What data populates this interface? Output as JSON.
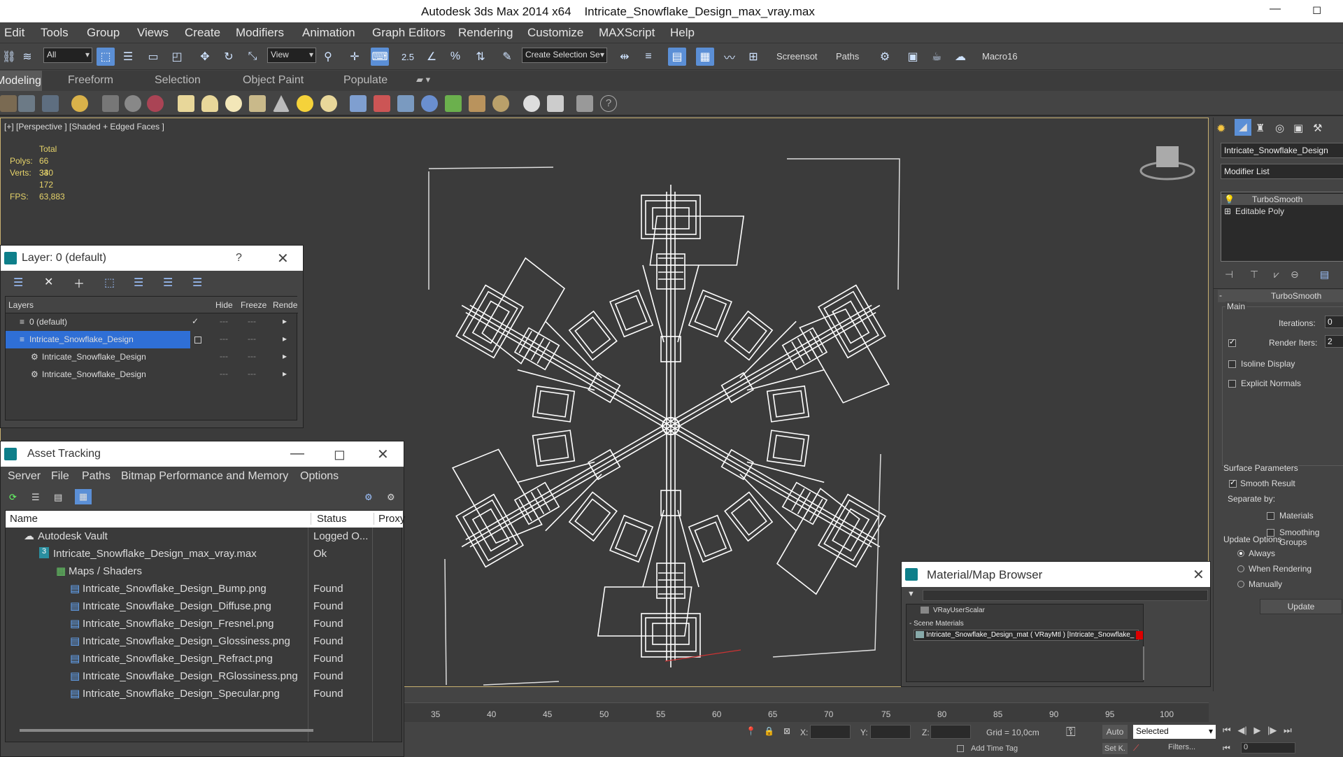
{
  "title_bar": {
    "app": "Autodesk 3ds Max 2014 x64",
    "file": "Intricate_Snowflake_Design_max_vray.max",
    "min": "—",
    "max": "◻"
  },
  "menu": [
    "Edit",
    "Tools",
    "Group",
    "Views",
    "Create",
    "Modifiers",
    "Animation",
    "Graph Editors",
    "Rendering",
    "Customize",
    "MAXScript",
    "Help"
  ],
  "toolbar": {
    "filter_select": "All",
    "ref_coord": "View",
    "snap_label": "2.5",
    "named_selection": "Create Selection Se",
    "screenshot": "Screensot",
    "paths": "Paths",
    "macro": "Macro16"
  },
  "ribbon_tabs": [
    "Modeling",
    "Freeform",
    "Selection",
    "Object Paint",
    "Populate"
  ],
  "viewport": {
    "label": "[+] [Perspective ] [Shaded + Edged Faces ]",
    "stats": {
      "total_label": "Total",
      "polys_label": "Polys:",
      "polys": "66 340",
      "verts_label": "Verts:",
      "verts": "33 172",
      "fps_label": "FPS:",
      "fps": "63,883"
    }
  },
  "layer_dialog": {
    "title": "Layer: 0 (default)",
    "help": "?",
    "close": "✕",
    "columns": [
      "Layers",
      "Hide",
      "Freeze",
      "Rende"
    ],
    "rows": [
      {
        "name": "0 (default)"
      },
      {
        "name": "Intricate_Snowflake_Design"
      },
      {
        "name": "Intricate_Snowflake_Design"
      },
      {
        "name": "Intricate_Snowflake_Design"
      }
    ]
  },
  "asset_tracking": {
    "title": "Asset Tracking",
    "menu": [
      "Server",
      "File",
      "Paths",
      "Bitmap Performance and Memory",
      "Options"
    ],
    "columns": [
      "Name",
      "Status",
      "Proxy"
    ],
    "rows": [
      {
        "name": "Autodesk Vault",
        "status": "Logged O..."
      },
      {
        "name": "Intricate_Snowflake_Design_max_vray.max",
        "status": "Ok"
      },
      {
        "name": "Maps / Shaders",
        "status": ""
      },
      {
        "name": "Intricate_Snowflake_Design_Bump.png",
        "status": "Found"
      },
      {
        "name": "Intricate_Snowflake_Design_Diffuse.png",
        "status": "Found"
      },
      {
        "name": "Intricate_Snowflake_Design_Fresnel.png",
        "status": "Found"
      },
      {
        "name": "Intricate_Snowflake_Design_Glossiness.png",
        "status": "Found"
      },
      {
        "name": "Intricate_Snowflake_Design_Refract.png",
        "status": "Found"
      },
      {
        "name": "Intricate_Snowflake_Design_RGlossiness.png",
        "status": "Found"
      },
      {
        "name": "Intricate_Snowflake_Design_Specular.png",
        "status": "Found"
      }
    ]
  },
  "command_panel": {
    "object_name": "Intricate_Snowflake_Design",
    "modifier_list": "Modifier List",
    "stack": [
      "TurboSmooth",
      "Editable Poly"
    ],
    "rollout_title": "TurboSmooth",
    "main_label": "Main",
    "iterations_label": "Iterations:",
    "iterations": "0",
    "render_iters_label": "Render Iters:",
    "render_iters": "2",
    "isoline": "Isoline Display",
    "explicit_normals": "Explicit Normals",
    "surface_params": "Surface Parameters",
    "smooth_result": "Smooth Result",
    "separate_by": "Separate by:",
    "materials": "Materials",
    "smoothing_groups": "Smoothing Groups",
    "update_options": "Update Options",
    "always": "Always",
    "when_rendering": "When Rendering",
    "manually": "Manually",
    "update_btn": "Update"
  },
  "material_browser": {
    "title": "Material/Map Browser",
    "close": "✕",
    "item": "VRayUserScalar",
    "section": "Scene Materials",
    "material": "Intricate_Snowflake_Design_mat ( VRayMtl ) [Intricate_Snowflake_"
  },
  "timeline": {
    "ticks": [
      "35",
      "40",
      "45",
      "50",
      "55",
      "60",
      "65",
      "70",
      "75",
      "80",
      "85",
      "90",
      "95",
      "100"
    ]
  },
  "status_bar": {
    "x_label": "X:",
    "y_label": "Y:",
    "z_label": "Z:",
    "grid": "Grid = 10,0cm",
    "auto": "Auto",
    "selected": "Selected",
    "set_key": "Set K.",
    "filters": "Filters...",
    "frame": "0",
    "add_time_tag": "Add Time Tag"
  },
  "colors": {
    "accent": "#5b8fd6",
    "selection": "#2f6fd6",
    "viewport_bg": "#3b3b3b",
    "wire": "#ffffff"
  }
}
